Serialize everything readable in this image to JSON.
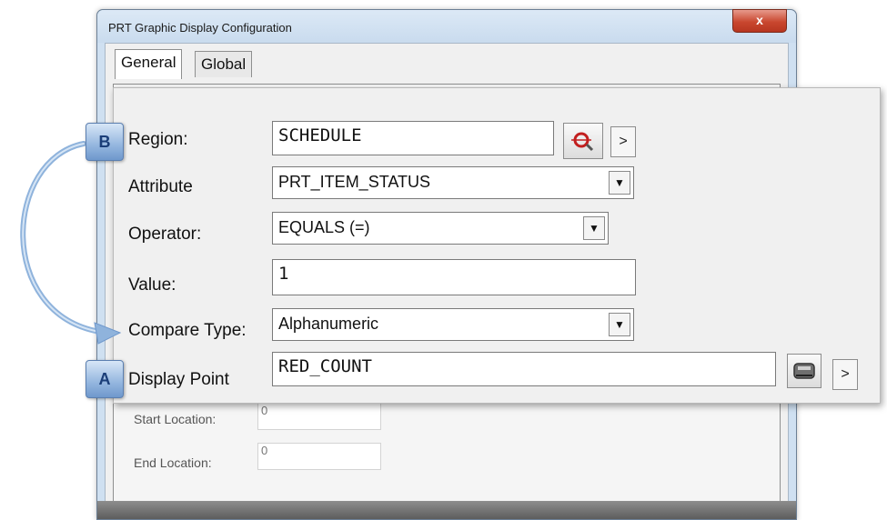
{
  "window": {
    "title": "PRT Graphic Display Configuration",
    "close_label": "x",
    "tabs": [
      {
        "label": "General"
      },
      {
        "label": "Global"
      }
    ]
  },
  "background_form": {
    "start_location": {
      "label": "Start Location:",
      "value": "0"
    },
    "end_location": {
      "label": "End Location:",
      "value": "0"
    }
  },
  "form": {
    "region": {
      "label": "Region:",
      "value": "SCHEDULE"
    },
    "attribute": {
      "label": "Attribute",
      "value": "PRT_ITEM_STATUS"
    },
    "operator": {
      "label": "Operator:",
      "value": "EQUALS (=)"
    },
    "value_field": {
      "label": "Value:",
      "value": "1"
    },
    "compare_type": {
      "label": "Compare Type:",
      "value": "Alphanumeric"
    },
    "display_point": {
      "label": "Display Point",
      "value": "RED_COUNT"
    }
  },
  "callouts": {
    "a": "A",
    "b": "B"
  },
  "icons": {
    "region_lookup": "search-target-icon",
    "display_point_lookup": "device-icon",
    "expand": "chevron-right-icon",
    "dropdown": "chevron-down-icon"
  },
  "colors": {
    "close_button": "#c9472f",
    "badge": "#94b6df",
    "arrow": "#8fb3dc"
  }
}
